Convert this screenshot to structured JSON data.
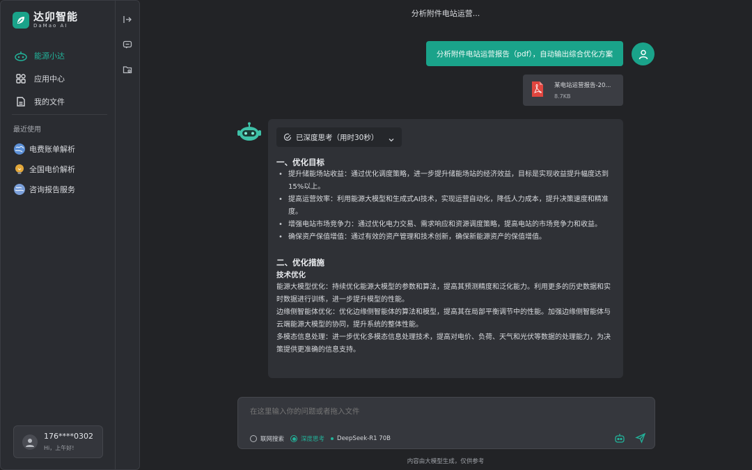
{
  "brand": {
    "name_cn": "达卯智能",
    "name_en": "DaMao AI"
  },
  "sidebar": {
    "nav": [
      {
        "label": "能源小达",
        "icon": "robot-icon",
        "active": true
      },
      {
        "label": "应用中心",
        "icon": "apps-icon",
        "active": false
      },
      {
        "label": "我的文件",
        "icon": "file-icon",
        "active": false
      }
    ],
    "recent_title": "最近使用",
    "recent": [
      {
        "label": "电费账单解析",
        "icon": "globe-icon"
      },
      {
        "label": "全国电价解析",
        "icon": "bulb-icon"
      },
      {
        "label": "咨询报告服务",
        "icon": "globe-icon"
      }
    ],
    "user": {
      "phone": "176****0302",
      "greeting": "Hi，上午好!"
    }
  },
  "rail": {
    "icons": [
      "collapse-icon",
      "chat-icon",
      "folder-settings-icon"
    ]
  },
  "conversation": {
    "title": "分析附件电站运营...",
    "user_message": "分析附件电站运营报告（pdf），自动输出综合优化方案",
    "file": {
      "name": "某电站运营报告-20...",
      "size": "8.7KB"
    },
    "thinking_label": "已深度思考（用时30秒）",
    "section1_title": "一、优化目标",
    "section1_items": [
      "提升储能场站收益：通过优化调度策略，进一步提升储能场站的经济效益，目标是实现收益提升幅度达到15%以上。",
      "提高运营效率：利用能源大模型和生成式AI技术，实现运营自动化，降低人力成本，提升决策速度和精准度。",
      "增强电站市场竞争力：通过优化电力交易、需求响应和资源调度策略，提高电站的市场竞争力和收益。",
      "确保资产保值增值：通过有效的资产管理和技术创新，确保新能源资产的保值增值。"
    ],
    "section2_title": "二、优化措施",
    "section2_sub": "技术优化",
    "section2_paras": [
      "能源大模型优化：持续优化能源大模型的参数和算法，提高其预测精度和泛化能力。利用更多的历史数据和实时数据进行训练，进一步提升模型的性能。",
      "边缘侧智能体优化：优化边缘侧智能体的算法和模型，提高其在局部平衡调节中的性能。加强边缘侧智能体与云端能源大模型的协同，提升系统的整体性能。",
      "多模态信息处理：进一步优化多模态信息处理技术，提高对电价、负荷、天气和光伏等数据的处理能力，为决策提供更准确的信息支持。"
    ]
  },
  "composer": {
    "placeholder": "在这里输入你的问题或者拖入文件",
    "web_search": "联网搜索",
    "deep_think": "深度思考",
    "model": "DeepSeek-R1 70B"
  },
  "disclaimer": "内容由大模型生成，仅供参考",
  "colors": {
    "accent": "#1aa38a",
    "bg": "#222326",
    "panel": "#2f3136"
  }
}
